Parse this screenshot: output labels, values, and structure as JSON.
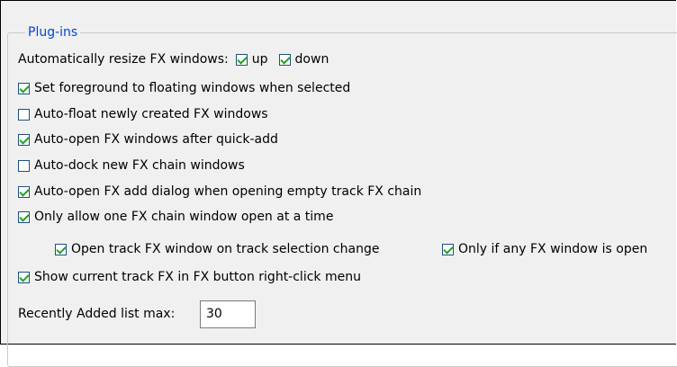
{
  "group_title": "Plug-ins",
  "resize_label": "Automatically resize FX windows:",
  "resize_up": {
    "label": "up",
    "checked": true
  },
  "resize_down": {
    "label": "down",
    "checked": true
  },
  "options": [
    {
      "label": "Set foreground to floating windows when selected",
      "checked": true
    },
    {
      "label": "Auto-float newly created FX windows",
      "checked": false
    },
    {
      "label": "Auto-open FX windows after quick-add",
      "checked": true
    },
    {
      "label": "Auto-dock new FX chain windows",
      "checked": false
    },
    {
      "label": "Auto-open FX add dialog when opening empty track FX chain",
      "checked": true
    },
    {
      "label": "Only allow one FX chain window open at a time",
      "checked": true
    }
  ],
  "sub_open_track": {
    "label": "Open track FX window on track selection change",
    "checked": true
  },
  "sub_only_if": {
    "label": "Only if any FX window is open",
    "checked": true
  },
  "show_current": {
    "label": "Show current track FX in FX button right-click menu",
    "checked": true
  },
  "recent_label": "Recently Added list max:",
  "recent_value": "30",
  "colors": {
    "accent": "#0046d5",
    "check": "#21a121",
    "border": "#1c5180"
  }
}
